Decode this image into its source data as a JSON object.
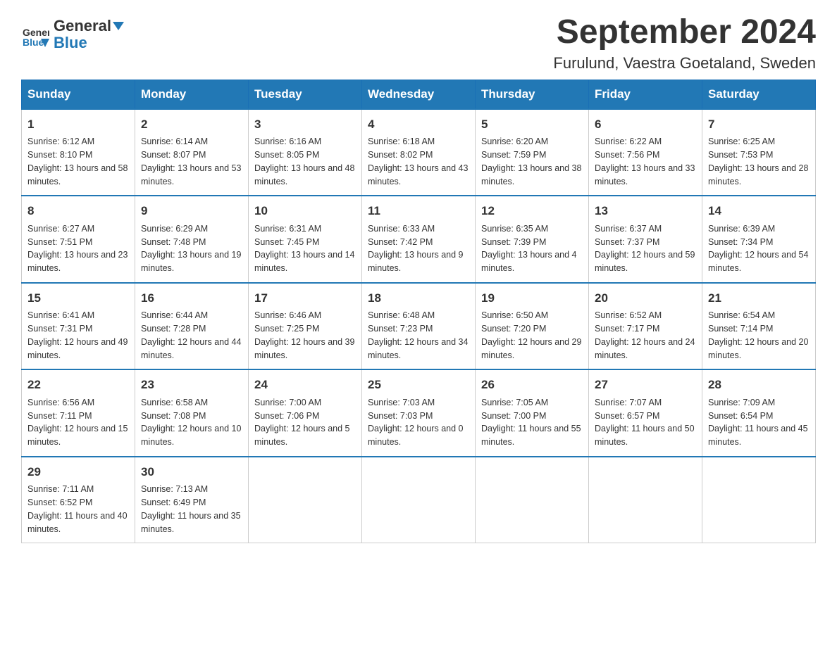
{
  "header": {
    "logo_general": "General",
    "logo_blue": "Blue",
    "title": "September 2024",
    "subtitle": "Furulund, Vaestra Goetaland, Sweden"
  },
  "weekdays": [
    "Sunday",
    "Monday",
    "Tuesday",
    "Wednesday",
    "Thursday",
    "Friday",
    "Saturday"
  ],
  "weeks": [
    [
      {
        "day": "1",
        "sunrise": "6:12 AM",
        "sunset": "8:10 PM",
        "daylight": "13 hours and 58 minutes."
      },
      {
        "day": "2",
        "sunrise": "6:14 AM",
        "sunset": "8:07 PM",
        "daylight": "13 hours and 53 minutes."
      },
      {
        "day": "3",
        "sunrise": "6:16 AM",
        "sunset": "8:05 PM",
        "daylight": "13 hours and 48 minutes."
      },
      {
        "day": "4",
        "sunrise": "6:18 AM",
        "sunset": "8:02 PM",
        "daylight": "13 hours and 43 minutes."
      },
      {
        "day": "5",
        "sunrise": "6:20 AM",
        "sunset": "7:59 PM",
        "daylight": "13 hours and 38 minutes."
      },
      {
        "day": "6",
        "sunrise": "6:22 AM",
        "sunset": "7:56 PM",
        "daylight": "13 hours and 33 minutes."
      },
      {
        "day": "7",
        "sunrise": "6:25 AM",
        "sunset": "7:53 PM",
        "daylight": "13 hours and 28 minutes."
      }
    ],
    [
      {
        "day": "8",
        "sunrise": "6:27 AM",
        "sunset": "7:51 PM",
        "daylight": "13 hours and 23 minutes."
      },
      {
        "day": "9",
        "sunrise": "6:29 AM",
        "sunset": "7:48 PM",
        "daylight": "13 hours and 19 minutes."
      },
      {
        "day": "10",
        "sunrise": "6:31 AM",
        "sunset": "7:45 PM",
        "daylight": "13 hours and 14 minutes."
      },
      {
        "day": "11",
        "sunrise": "6:33 AM",
        "sunset": "7:42 PM",
        "daylight": "13 hours and 9 minutes."
      },
      {
        "day": "12",
        "sunrise": "6:35 AM",
        "sunset": "7:39 PM",
        "daylight": "13 hours and 4 minutes."
      },
      {
        "day": "13",
        "sunrise": "6:37 AM",
        "sunset": "7:37 PM",
        "daylight": "12 hours and 59 minutes."
      },
      {
        "day": "14",
        "sunrise": "6:39 AM",
        "sunset": "7:34 PM",
        "daylight": "12 hours and 54 minutes."
      }
    ],
    [
      {
        "day": "15",
        "sunrise": "6:41 AM",
        "sunset": "7:31 PM",
        "daylight": "12 hours and 49 minutes."
      },
      {
        "day": "16",
        "sunrise": "6:44 AM",
        "sunset": "7:28 PM",
        "daylight": "12 hours and 44 minutes."
      },
      {
        "day": "17",
        "sunrise": "6:46 AM",
        "sunset": "7:25 PM",
        "daylight": "12 hours and 39 minutes."
      },
      {
        "day": "18",
        "sunrise": "6:48 AM",
        "sunset": "7:23 PM",
        "daylight": "12 hours and 34 minutes."
      },
      {
        "day": "19",
        "sunrise": "6:50 AM",
        "sunset": "7:20 PM",
        "daylight": "12 hours and 29 minutes."
      },
      {
        "day": "20",
        "sunrise": "6:52 AM",
        "sunset": "7:17 PM",
        "daylight": "12 hours and 24 minutes."
      },
      {
        "day": "21",
        "sunrise": "6:54 AM",
        "sunset": "7:14 PM",
        "daylight": "12 hours and 20 minutes."
      }
    ],
    [
      {
        "day": "22",
        "sunrise": "6:56 AM",
        "sunset": "7:11 PM",
        "daylight": "12 hours and 15 minutes."
      },
      {
        "day": "23",
        "sunrise": "6:58 AM",
        "sunset": "7:08 PM",
        "daylight": "12 hours and 10 minutes."
      },
      {
        "day": "24",
        "sunrise": "7:00 AM",
        "sunset": "7:06 PM",
        "daylight": "12 hours and 5 minutes."
      },
      {
        "day": "25",
        "sunrise": "7:03 AM",
        "sunset": "7:03 PM",
        "daylight": "12 hours and 0 minutes."
      },
      {
        "day": "26",
        "sunrise": "7:05 AM",
        "sunset": "7:00 PM",
        "daylight": "11 hours and 55 minutes."
      },
      {
        "day": "27",
        "sunrise": "7:07 AM",
        "sunset": "6:57 PM",
        "daylight": "11 hours and 50 minutes."
      },
      {
        "day": "28",
        "sunrise": "7:09 AM",
        "sunset": "6:54 PM",
        "daylight": "11 hours and 45 minutes."
      }
    ],
    [
      {
        "day": "29",
        "sunrise": "7:11 AM",
        "sunset": "6:52 PM",
        "daylight": "11 hours and 40 minutes."
      },
      {
        "day": "30",
        "sunrise": "7:13 AM",
        "sunset": "6:49 PM",
        "daylight": "11 hours and 35 minutes."
      },
      null,
      null,
      null,
      null,
      null
    ]
  ]
}
